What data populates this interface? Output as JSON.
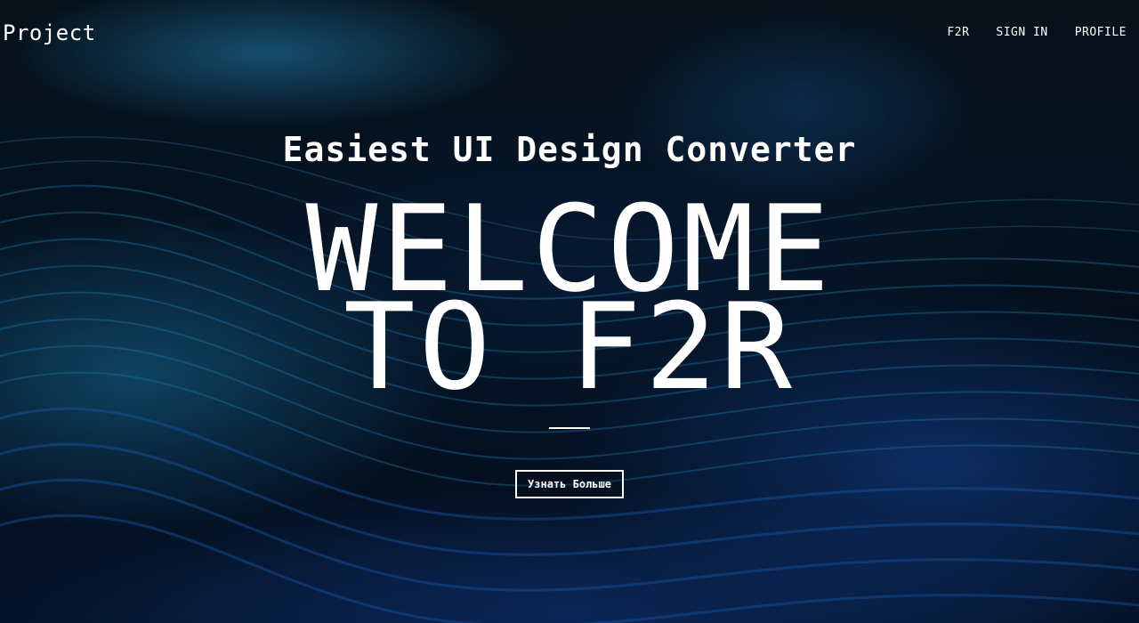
{
  "header": {
    "logo": "Project",
    "nav": [
      {
        "label": "F2R"
      },
      {
        "label": "SIGN IN"
      },
      {
        "label": "PROFILE"
      }
    ]
  },
  "hero": {
    "subtitle": "Easiest UI Design Converter",
    "headline_line1": "WELCOME",
    "headline_line2": "TO F2R",
    "cta_label": "Узнать Больше"
  },
  "colors": {
    "text": "#ffffff",
    "background_dark": "#05080f",
    "accent_blue": "#1e7fd0"
  }
}
